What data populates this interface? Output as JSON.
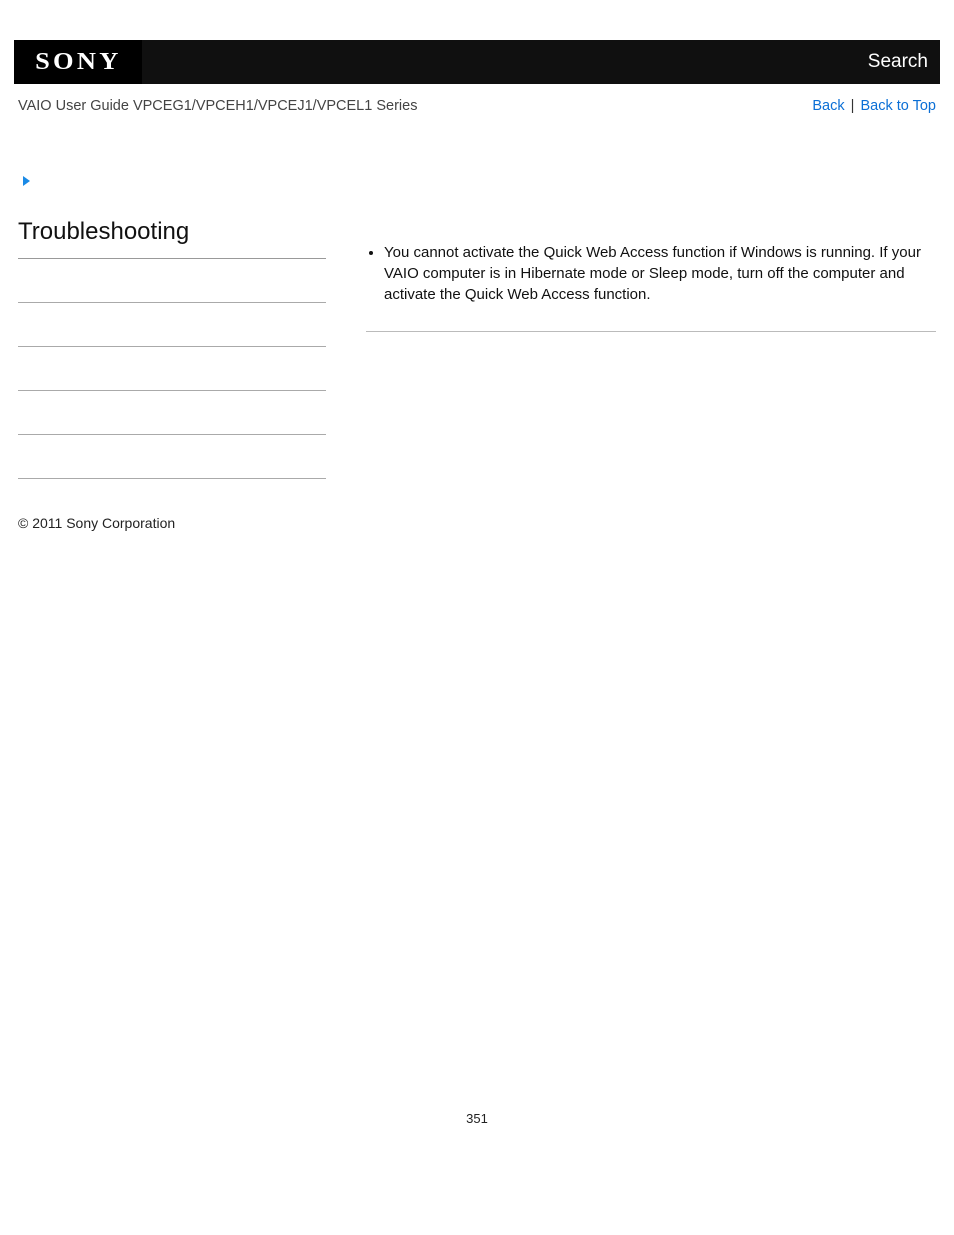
{
  "header": {
    "logo_text": "SONY",
    "search_label": "Search"
  },
  "subheader": {
    "guide_title": "VAIO User Guide VPCEG1/VPCEH1/VPCEJ1/VPCEL1 Series",
    "back_label": "Back",
    "back_to_top_label": "Back to Top",
    "separator": "|"
  },
  "sidebar": {
    "title": "Troubleshooting",
    "items": [
      "",
      "",
      "",
      "",
      ""
    ]
  },
  "main": {
    "bullets": [
      "You cannot activate the Quick Web Access function if Windows is running. If your VAIO computer is in Hibernate mode or Sleep mode, turn off the computer and activate the Quick Web Access function."
    ]
  },
  "footer": {
    "copyright": "© 2011 Sony Corporation",
    "page_number": "351"
  }
}
